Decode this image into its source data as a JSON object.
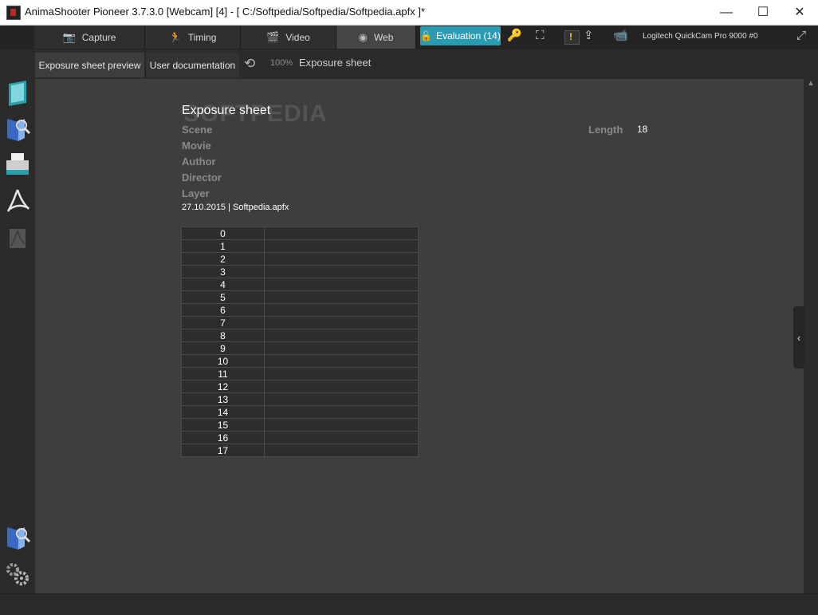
{
  "window": {
    "title": "AnimaShooter Pioneer 3.7.3.0 [Webcam] [4]  - [ C:/Softpedia/Softpedia/Softpedia.apfx ]*",
    "minimize": "—",
    "maximize": "☐",
    "close": "✕"
  },
  "main_tabs": [
    {
      "label": "Capture",
      "icon": "camera-icon"
    },
    {
      "label": "Timing",
      "icon": "running-man-icon"
    },
    {
      "label": "Video",
      "icon": "clapperboard-icon"
    },
    {
      "label": "Web",
      "icon": "globe-icon"
    }
  ],
  "toolbar": {
    "evaluation_label": "Evaluation (14)",
    "camera_name": "Logitech QuickCam Pro 9000 #0",
    "accent_color": "#2a9bb0"
  },
  "sub_tabs": [
    {
      "label": "Exposure sheet preview"
    },
    {
      "label": "User documentation"
    }
  ],
  "zoom": "100%",
  "breadcrumb": "Exposure sheet",
  "sheet": {
    "watermark": "SOFTPEDIA",
    "title": "Exposure sheet",
    "fields": [
      "Scene",
      "Movie",
      "Author",
      "Director",
      "Layer"
    ],
    "length_label": "Length",
    "length_value": "18",
    "date_line": "27.10.2015 | Softpedia.apfx",
    "frames": [
      "0",
      "1",
      "2",
      "3",
      "4",
      "5",
      "6",
      "7",
      "8",
      "9",
      "10",
      "11",
      "12",
      "13",
      "14",
      "15",
      "16",
      "17"
    ]
  }
}
